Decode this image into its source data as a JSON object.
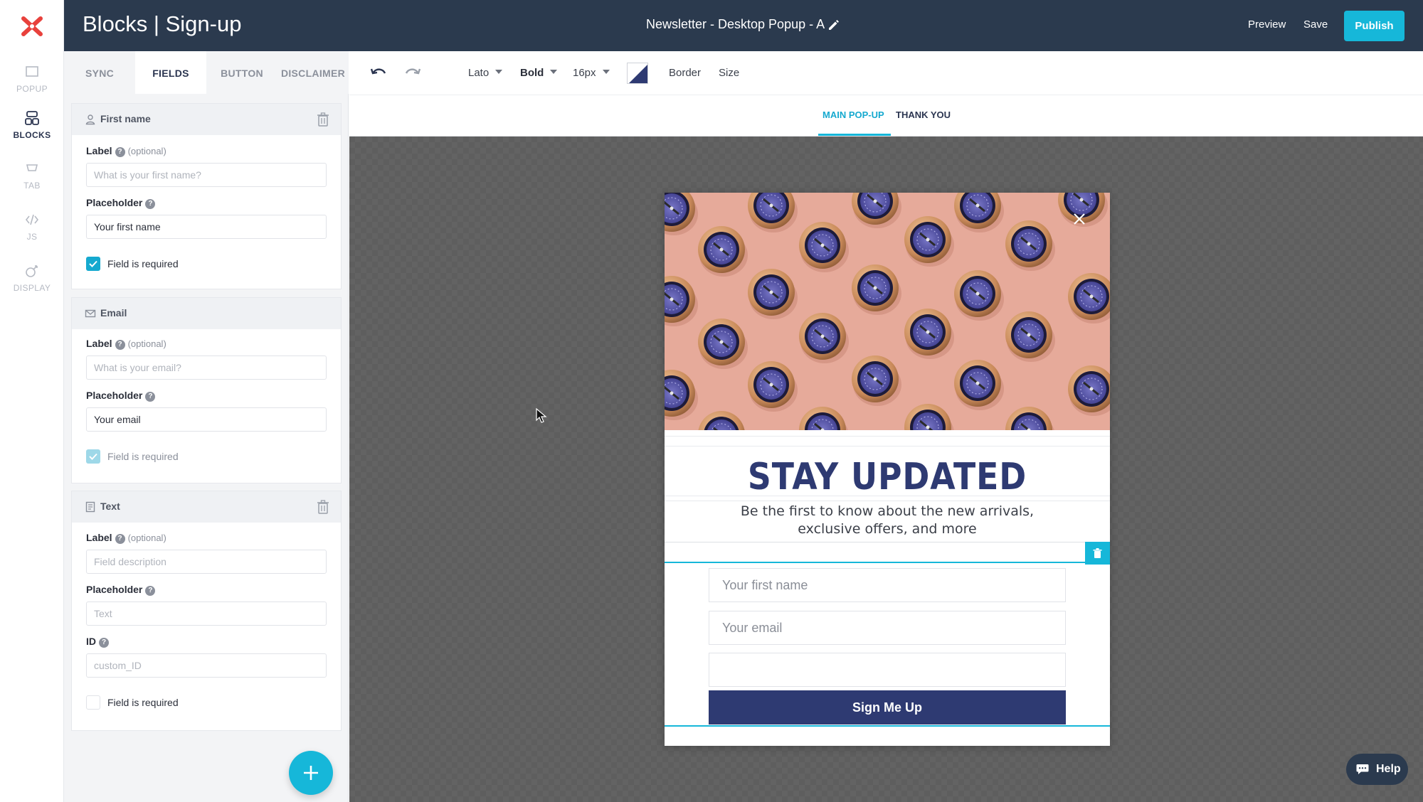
{
  "header": {
    "app_title": "Blocks | Sign-up",
    "doc_title": "Newsletter - Desktop Popup - A",
    "preview_label": "Preview",
    "save_label": "Save",
    "publish_label": "Publish"
  },
  "rail": {
    "items": [
      {
        "label": "POPUP",
        "icon": "popup-icon"
      },
      {
        "label": "BLOCKS",
        "icon": "blocks-icon",
        "active": true
      },
      {
        "label": "TAB",
        "icon": "tab-icon"
      },
      {
        "label": "JS",
        "icon": "code-icon"
      },
      {
        "label": "DISPLAY",
        "icon": "display-icon"
      }
    ]
  },
  "panel": {
    "tabs": [
      "SYNC",
      "FIELDS",
      "BUTTON",
      "DISCLAIMER"
    ],
    "active_tab": "FIELDS",
    "fields": [
      {
        "title": "First name",
        "icon": "user-icon",
        "label_caption": "Label",
        "optional": "(optional)",
        "label_placeholder": "What is your first name?",
        "placeholder_caption": "Placeholder",
        "placeholder_value": "Your first name",
        "required_label": "Field is required",
        "required": true
      },
      {
        "title": "Email",
        "icon": "envelope-icon",
        "label_caption": "Label",
        "optional": "(optional)",
        "label_placeholder": "What is your email?",
        "placeholder_caption": "Placeholder",
        "placeholder_value": "Your email",
        "required_label": "Field is required",
        "required": true,
        "required_locked": true
      },
      {
        "title": "Text",
        "icon": "text-doc-icon",
        "label_caption": "Label",
        "optional": "(optional)",
        "label_placeholder": "Field description",
        "placeholder_caption": "Placeholder",
        "placeholder_placeholder": "Text",
        "id_caption": "ID",
        "id_placeholder": "custom_ID",
        "required_label": "Field is required",
        "required": false
      }
    ]
  },
  "toolbar": {
    "font": "Lato",
    "weight": "Bold",
    "size": "16px",
    "border_label": "Border",
    "size_label": "Size",
    "swatch_colors": [
      "#ffffff",
      "#2e3a72"
    ]
  },
  "view_tabs": {
    "items": [
      "MAIN POP-UP",
      "THANK YOU"
    ],
    "active": "MAIN POP-UP"
  },
  "popup": {
    "headline": "STAY UPDATED",
    "subtext": "Be the first to know about the new arrivals, exclusive offers, and more",
    "inputs": [
      "Your first name",
      "Your email",
      ""
    ],
    "button_label": "Sign Me Up"
  },
  "help_label": "Help",
  "colors": {
    "header_bg": "#2b3a4e",
    "accent": "#16b7d9",
    "brand_navy": "#2e3a72",
    "logo_red": "#e8413c"
  }
}
